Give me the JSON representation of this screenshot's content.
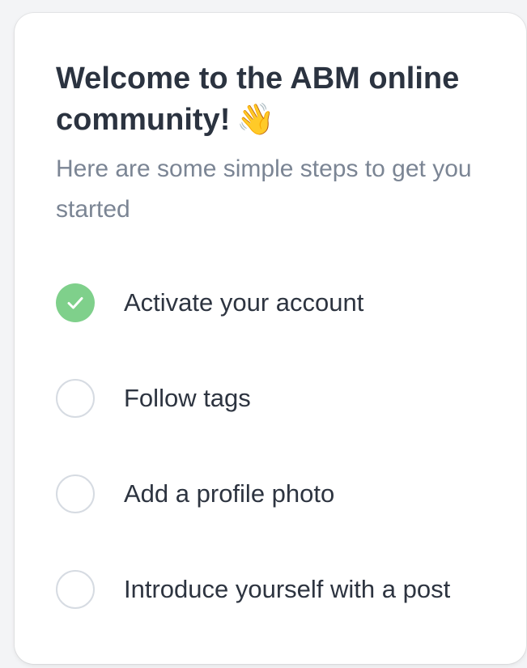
{
  "welcome": {
    "title": "Welcome to the ABM online community!",
    "wave_emoji": "👋",
    "subtitle": "Here are some simple steps to get you started"
  },
  "steps": [
    {
      "label": "Activate your account",
      "completed": true
    },
    {
      "label": "Follow tags",
      "completed": false
    },
    {
      "label": "Add a profile photo",
      "completed": false
    },
    {
      "label": "Introduce yourself with a post",
      "completed": false
    }
  ],
  "colors": {
    "completed_green": "#7fd08b",
    "title_text": "#2b3340",
    "subtitle_text": "#7b8594",
    "circle_border": "#d6dbe2"
  }
}
